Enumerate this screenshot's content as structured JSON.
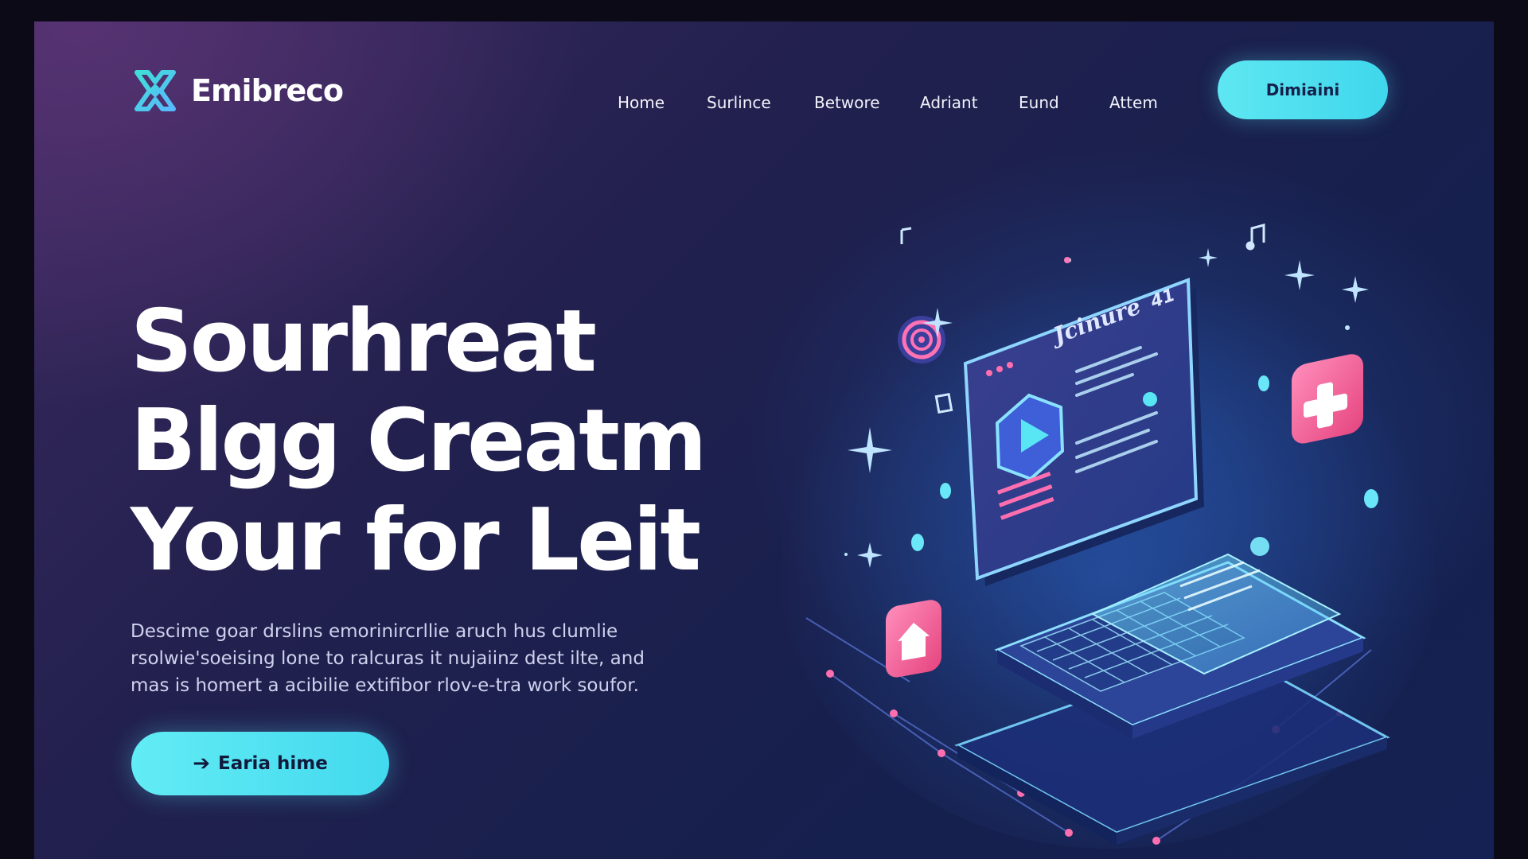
{
  "brand": {
    "name": "Emibreco",
    "logo_icon": "x-logo-icon",
    "accent": "#4fe0ef",
    "pink": "#f0649c"
  },
  "nav": {
    "items": [
      {
        "label": "Home"
      },
      {
        "label": "Surlince"
      },
      {
        "label": "Betwore"
      },
      {
        "label": "Adriant"
      },
      {
        "label": "Eund"
      },
      {
        "label": "Attem"
      }
    ],
    "cta_label": "Dimiaini"
  },
  "hero": {
    "title_lines": [
      "Sourhreat",
      "Blgg Creatm",
      "Your  for Leit"
    ],
    "description_lines": [
      "Descime goar drslins emorinircrllie aruch hus clumlie",
      "rsolwie'soeising lone to ralcuras it nujaiinz dest ilte, and",
      "mas is homert a acibilie extifibor rlov-e-tra work soufor."
    ],
    "cta_label": "Earia hime",
    "cta_icon": "arrow-right-icon"
  },
  "illustration": {
    "screen_title": "Jcinure",
    "screen_badge": "41",
    "icons": [
      "play-icon",
      "plus-icon",
      "home-icon",
      "target-icon",
      "music-note-icon"
    ]
  }
}
